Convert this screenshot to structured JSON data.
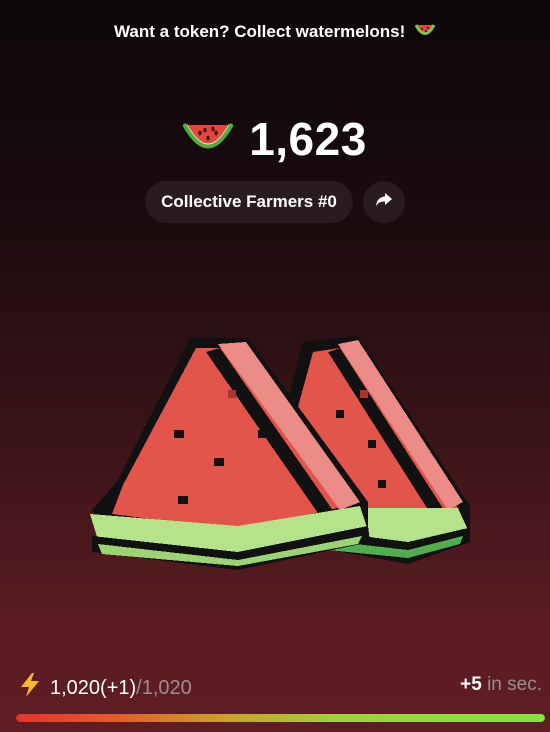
{
  "header": {
    "prompt": "Want a token? Collect watermelons!",
    "prompt_icon": "watermelon-icon"
  },
  "score": {
    "icon": "watermelon-icon",
    "value": "1,623"
  },
  "team": {
    "label": "Collective Farmers #0",
    "share_icon": "share-arrow-icon"
  },
  "energy": {
    "icon": "lightning-icon",
    "current": "1,020(+1)",
    "separator": "/",
    "max": "1,020",
    "fill_fraction": 1.0
  },
  "regen": {
    "plus": "+5",
    "suffix": "in sec."
  },
  "colors": {
    "accent_red": "#e8322d",
    "accent_green": "#84e33e",
    "pill_bg": "#2a1c1e",
    "muted_text": "#9a8f90"
  }
}
